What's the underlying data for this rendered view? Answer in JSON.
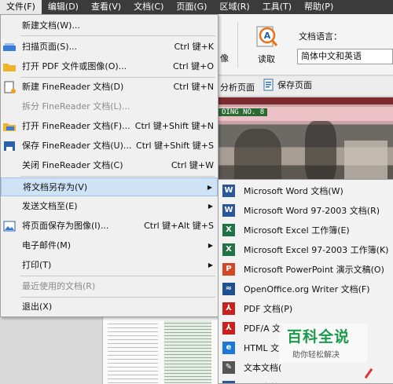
{
  "menubar": [
    "文件(F)",
    "编辑(D)",
    "查看(V)",
    "文档(C)",
    "页面(G)",
    "区域(R)",
    "工具(T)",
    "帮助(P)"
  ],
  "toolbar": {
    "partial_label": "像",
    "read_label": "读取",
    "language_label": "文档语言：",
    "language_value": "简体中文和英语",
    "analyze_label": "分析页面",
    "save_page_label": "保存页面"
  },
  "image_tag": "OING NO. 8",
  "file_menu": {
    "new_doc": "新建文档(W)...",
    "scan": {
      "label": "扫描页面(S)...",
      "shortcut": "Ctrl 键+K"
    },
    "open_pdf": {
      "label": "打开 PDF 文件或图像(O)...",
      "shortcut": "Ctrl 键+O"
    },
    "new_fr": {
      "label": "新建 FineReader 文档(D)",
      "shortcut": "Ctrl 键+N"
    },
    "split_fr": {
      "label": "拆分 FineReader 文档(L)..."
    },
    "open_fr": {
      "label": "打开 FineReader 文档(F)...",
      "shortcut": "Ctrl 键+Shift 键+N"
    },
    "save_fr": {
      "label": "保存 FineReader 文档(U)...",
      "shortcut": "Ctrl 键+Shift 键+S"
    },
    "close_fr": {
      "label": "关闭 FineReader 文档(C)",
      "shortcut": "Ctrl 键+W"
    },
    "save_as": {
      "label": "将文档另存为(V)"
    },
    "send_to": {
      "label": "发送文档至(E)"
    },
    "save_image": {
      "label": "将页面保存为图像(I)...",
      "shortcut": "Ctrl 键+Alt 键+S"
    },
    "email": {
      "label": "电子邮件(M)"
    },
    "print": {
      "label": "打印(T)"
    },
    "recent": {
      "label": "最近使用的文档(R)"
    },
    "exit": {
      "label": "退出(X)"
    }
  },
  "submenu": [
    {
      "label": "Microsoft Word 文档(W)",
      "icon": "word-icon",
      "color": "#2b579a",
      "glyph": "W"
    },
    {
      "label": "Microsoft Word 97-2003 文档(R)",
      "icon": "word-icon",
      "color": "#2b579a",
      "glyph": "W"
    },
    {
      "label": "Microsoft Excel 工作簿(E)",
      "icon": "excel-icon",
      "color": "#217346",
      "glyph": "X"
    },
    {
      "label": "Microsoft Excel 97-2003 工作簿(K)",
      "icon": "excel-icon",
      "color": "#217346",
      "glyph": "X"
    },
    {
      "label": "Microsoft PowerPoint 演示文稿(O)",
      "icon": "powerpoint-icon",
      "color": "#d24726",
      "glyph": "P"
    },
    {
      "label": "OpenOffice.org Writer 文档(F)",
      "icon": "openoffice-icon",
      "color": "#1d4f91",
      "glyph": "≈"
    },
    {
      "label": "PDF 文档(P)",
      "icon": "pdf-icon",
      "color": "#c8201c",
      "glyph": "⅄"
    },
    {
      "label": "PDF/A 文",
      "icon": "pdf-icon",
      "color": "#c8201c",
      "glyph": "⅄"
    },
    {
      "label": "HTML 文",
      "icon": "html-icon",
      "color": "#1b78d4",
      "glyph": "e"
    },
    {
      "label": "文本文档(",
      "icon": "text-icon",
      "color": "#555555",
      "glyph": "✎"
    },
    {
      "label": "RTF 文档(",
      "icon": "rtf-icon",
      "color": "#2b579a",
      "glyph": "W"
    }
  ],
  "watermark": {
    "title": "百科全说",
    "subtitle": "助你轻松解决"
  }
}
